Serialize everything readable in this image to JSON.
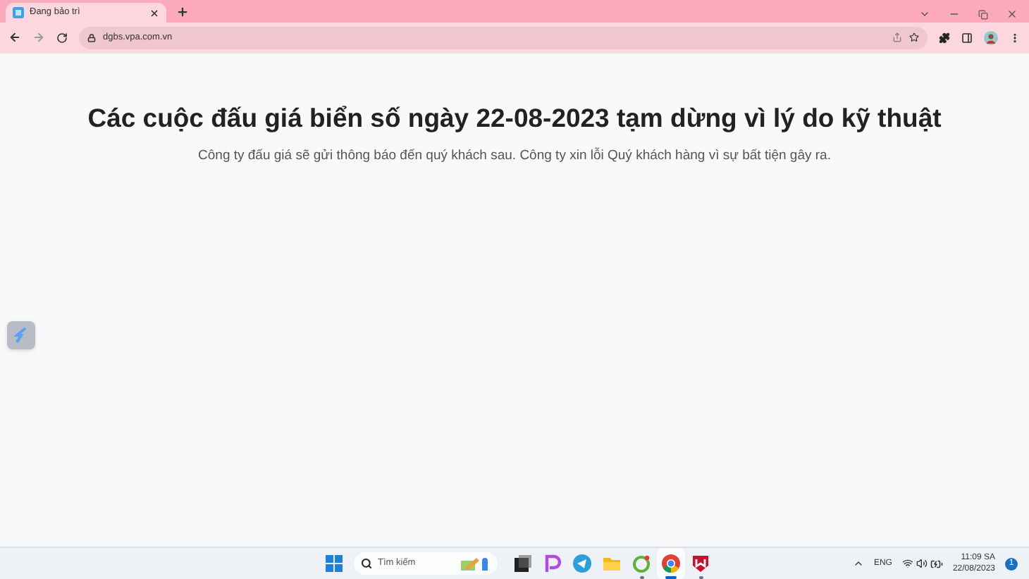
{
  "browser": {
    "tab": {
      "title": "Đang bảo trì",
      "selected": true
    },
    "address": "dgbs.vpa.com.vn"
  },
  "page": {
    "heading": "Các cuộc đấu giá biển số ngày 22-08-2023 tạm dừng vì lý do kỹ thuật",
    "message": "Công ty đấu giá sẽ gửi thông báo đến quý khách sau. Công ty xin lỗi Quý khách hàng vì sự bất tiện gây ra."
  },
  "taskbar": {
    "search_placeholder": "Tìm kiếm",
    "apps": [
      {
        "kind": "taskview",
        "running": false,
        "selected": false
      },
      {
        "kind": "p",
        "running": false,
        "selected": false
      },
      {
        "kind": "telegram",
        "running": false,
        "selected": false
      },
      {
        "kind": "folder",
        "running": false,
        "selected": false
      },
      {
        "kind": "green",
        "running": true,
        "selected": false
      },
      {
        "kind": "chrome",
        "running": true,
        "selected": true
      },
      {
        "kind": "shield",
        "running": true,
        "selected": false
      }
    ],
    "language": "ENG",
    "time": "11:09 SA",
    "date": "22/08/2023",
    "notifications": "1"
  }
}
